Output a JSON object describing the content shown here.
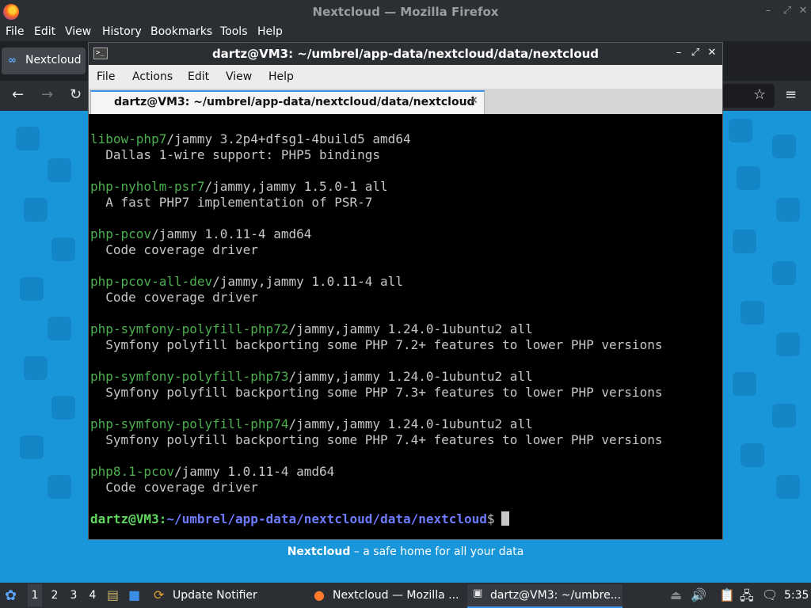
{
  "firefox": {
    "window_title": "Nextcloud — Mozilla Firefox",
    "menu": [
      "File",
      "Edit",
      "View",
      "History",
      "Bookmarks",
      "Tools",
      "Help"
    ],
    "tab_label": "Nextcloud",
    "page_footer_bold": "Nextcloud",
    "page_footer_rest": " – a safe home for all your data"
  },
  "terminal": {
    "window_title": "dartz@VM3: ~/umbrel/app-data/nextcloud/data/nextcloud",
    "menu": [
      "File",
      "Actions",
      "Edit",
      "View",
      "Help"
    ],
    "tab_label": "dartz@VM3: ~/umbrel/app-data/nextcloud/data/nextcloud",
    "entries": [
      {
        "pkg": "libow-php7",
        "rest": "/jammy 3.2p4+dfsg1-4build5 amd64",
        "desc": "  Dallas 1-wire support: PHP5 bindings"
      },
      {
        "pkg": "php-nyholm-psr7",
        "rest": "/jammy,jammy 1.5.0-1 all",
        "desc": "  A fast PHP7 implementation of PSR-7"
      },
      {
        "pkg": "php-pcov",
        "rest": "/jammy 1.0.11-4 amd64",
        "desc": "  Code coverage driver"
      },
      {
        "pkg": "php-pcov-all-dev",
        "rest": "/jammy,jammy 1.0.11-4 all",
        "desc": "  Code coverage driver"
      },
      {
        "pkg": "php-symfony-polyfill-php72",
        "rest": "/jammy,jammy 1.24.0-1ubuntu2 all",
        "desc": "  Symfony polyfill backporting some PHP 7.2+ features to lower PHP versions"
      },
      {
        "pkg": "php-symfony-polyfill-php73",
        "rest": "/jammy,jammy 1.24.0-1ubuntu2 all",
        "desc": "  Symfony polyfill backporting some PHP 7.3+ features to lower PHP versions"
      },
      {
        "pkg": "php-symfony-polyfill-php74",
        "rest": "/jammy,jammy 1.24.0-1ubuntu2 all",
        "desc": "  Symfony polyfill backporting some PHP 7.4+ features to lower PHP versions"
      },
      {
        "pkg": "php8.1-pcov",
        "rest": "/jammy 1.0.11-4 amd64",
        "desc": "  Code coverage driver"
      }
    ],
    "prompt_user": "dartz@VM3",
    "prompt_sep": ":",
    "prompt_path": "~/umbrel/app-data/nextcloud/data/nextcloud",
    "prompt_symbol": "$"
  },
  "taskbar": {
    "workspaces": [
      "1",
      "2",
      "3",
      "4"
    ],
    "update_notifier": "Update Notifier",
    "firefox_task": "Nextcloud — Mozilla ...",
    "terminal_task": "dartz@VM3: ~/umbre...",
    "clock": "5:35"
  },
  "colors": {
    "desktop_blue": "#1996d9",
    "pkg_green": "#4caf50",
    "prompt_user": "#5fd75f",
    "prompt_path": "#6f7bff"
  }
}
